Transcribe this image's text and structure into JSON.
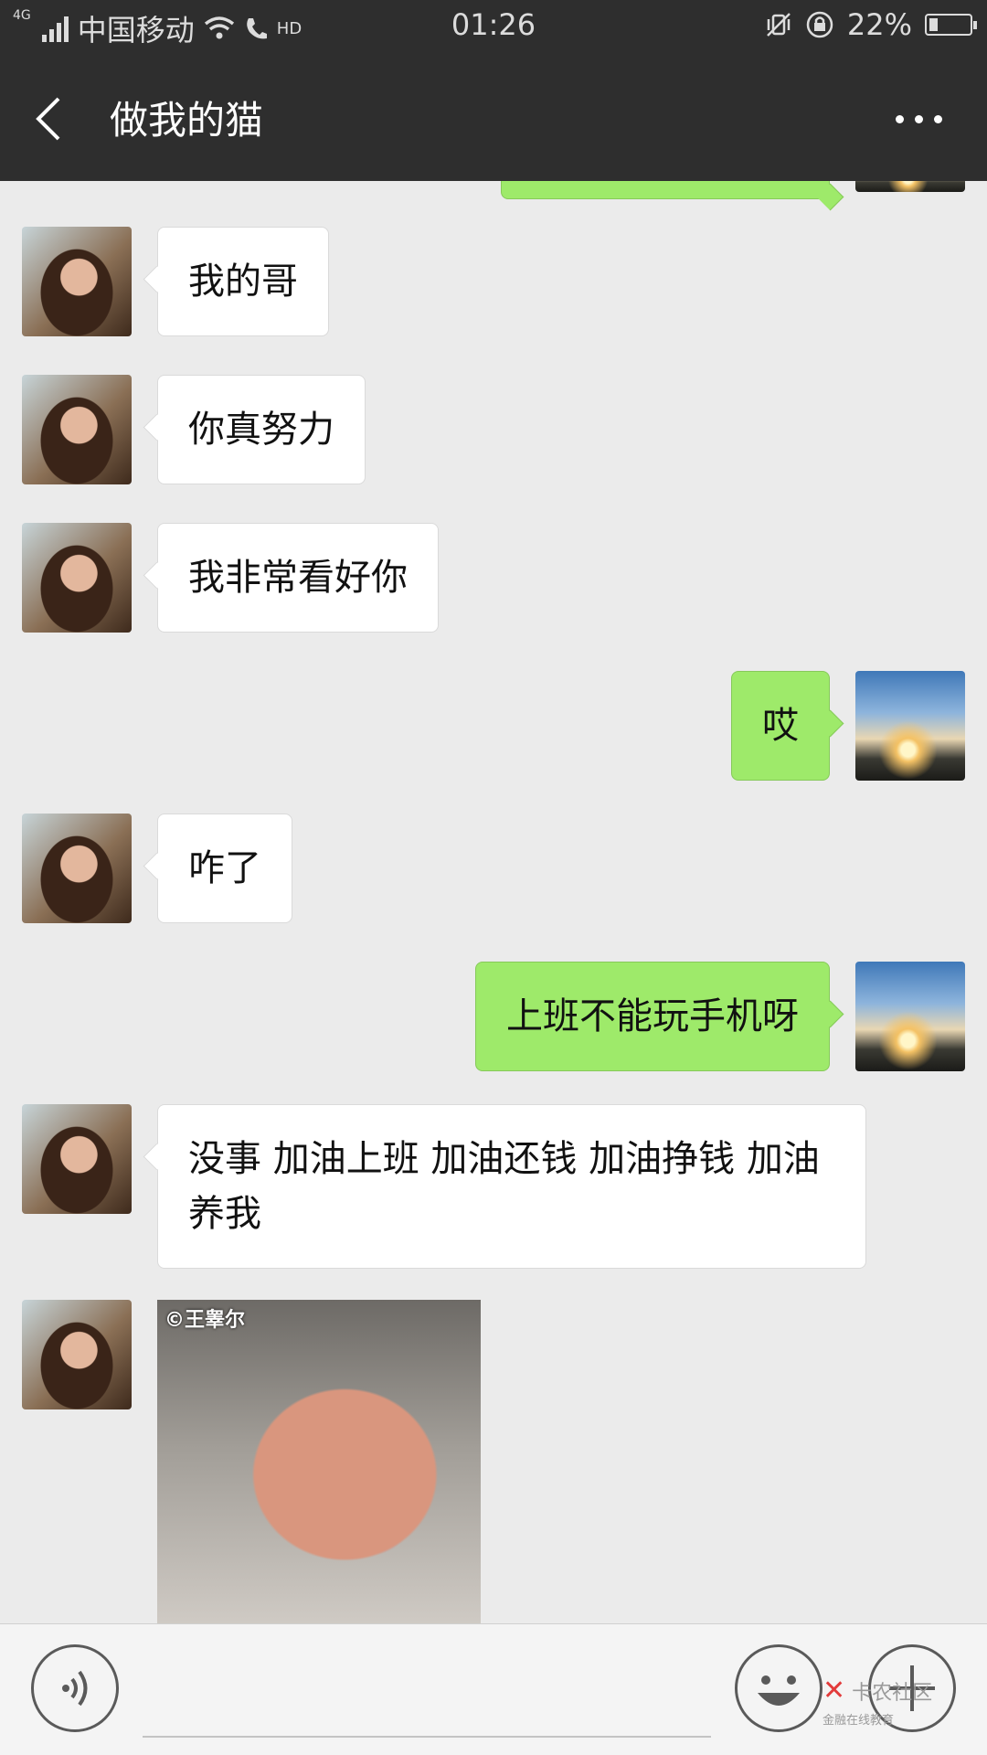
{
  "status_bar": {
    "network": "4G",
    "carrier": "中国移动",
    "hd": "HD",
    "time": "01:26",
    "battery_percent": "22%",
    "battery_level": 0.22
  },
  "header": {
    "title": "做我的猫",
    "back_icon": "chevron-left-icon",
    "more_icon": "more-dots-icon"
  },
  "messages": [
    {
      "side": "in",
      "text": "我的哥"
    },
    {
      "side": "in",
      "text": "你真努力"
    },
    {
      "side": "in",
      "text": "我非常看好你"
    },
    {
      "side": "out",
      "text": "哎"
    },
    {
      "side": "in",
      "text": "咋了"
    },
    {
      "side": "out",
      "text": "上班不能玩手机呀"
    },
    {
      "side": "in",
      "text": "没事 加油上班 加油还钱 加油挣钱 加油养我"
    },
    {
      "side": "in",
      "type": "sticker",
      "watermark": "©王睾尔"
    }
  ],
  "input_bar": {
    "voice_icon": "voice-icon",
    "emoji_icon": "emoji-icon",
    "plus_icon": "plus-icon",
    "text_value": ""
  },
  "watermark": {
    "text": "卡农社区",
    "sub": "金融在线教育"
  },
  "colors": {
    "bar": "#2e2e2e",
    "background": "#ebebeb",
    "bubble_out": "#9eea6a",
    "bubble_in": "#ffffff"
  }
}
